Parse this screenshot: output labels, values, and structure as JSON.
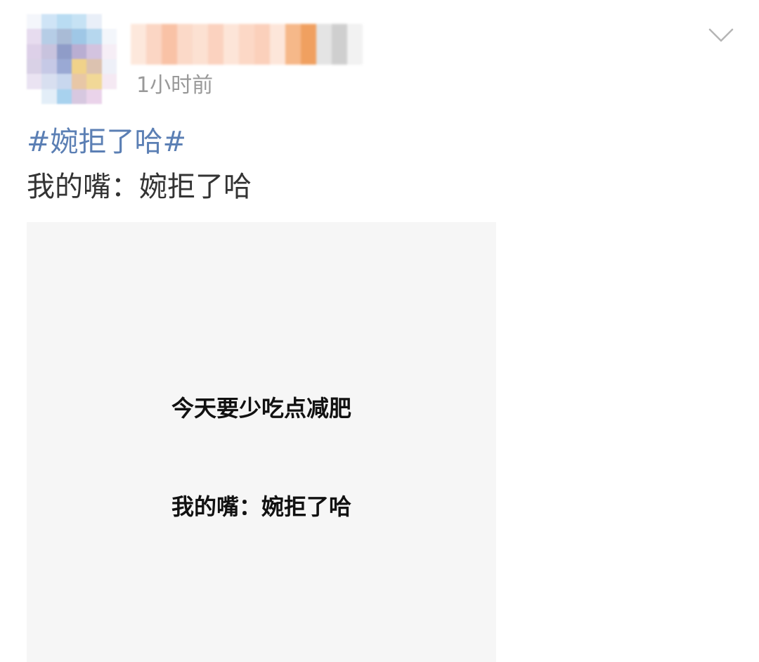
{
  "header": {
    "time_label": "1小时前",
    "menu_icon": "chevron-down-icon"
  },
  "post": {
    "hashtag": "#婉拒了哈#",
    "text": "我的嘴：婉拒了哈"
  },
  "image": {
    "line_1": "今天要少吃点减肥",
    "line_2": "我的嘴：婉拒了哈"
  },
  "colors": {
    "hashtag": "#5b7fb4",
    "time": "#999999",
    "body": "#333333",
    "image_bg": "#f6f6f6"
  }
}
